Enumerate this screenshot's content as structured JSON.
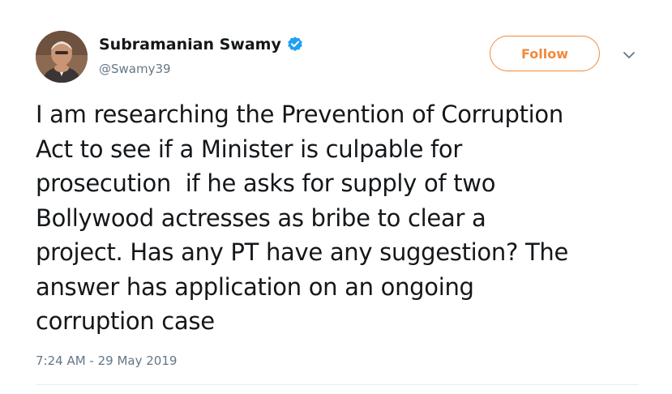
{
  "author": {
    "display_name": "Subramanian Swamy",
    "handle": "@Swamy39",
    "verified": true
  },
  "actions": {
    "follow_label": "Follow",
    "more_icon": "chevron-down-icon"
  },
  "tweet": {
    "lines": [
      "I am researching the Prevention of Corruption",
      "Act to see if a Minister is culpable for",
      "prosecution  if he asks for supply of two",
      "Bollywood actresses as bribe to clear a",
      "project. Has any PT have any suggestion? The",
      "answer has application on an ongoing",
      "corruption case"
    ],
    "timestamp": "7:24 AM - 29 May 2019"
  },
  "colors": {
    "accent": "#f08a3c",
    "verified_badge": "#1da1f2",
    "secondary_text": "#657786",
    "primary_text": "#14171a",
    "divider": "#e6ecf0"
  }
}
